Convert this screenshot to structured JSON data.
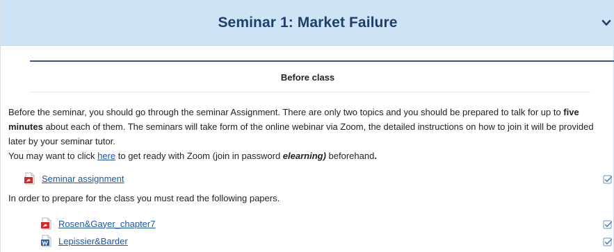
{
  "section": {
    "title": "Seminar 1: Market Failure"
  },
  "summary": {
    "heading": "Before class",
    "intro_part1": "Before the seminar, you should go through the seminar Assignment. There are only two topics and you should be prepared to talk for up to ",
    "intro_bold": "five minutes",
    "intro_part2": " about each of them.  The seminars will take form of the online webinar via Zoom, the detailed instructions on how to join it will be provided later by your seminar tutor.",
    "zoom_part1": "You may want to click ",
    "zoom_link": "here",
    "zoom_part2": " to get ready with Zoom (join in password ",
    "zoom_password": "elearning)",
    "zoom_part3": " beforehand",
    "zoom_end": "."
  },
  "activities": [
    {
      "label": "Seminar assignment",
      "icon": "pdf-icon"
    },
    {
      "label": "Rosen&Gayer_chapter7",
      "icon": "pdf-icon"
    },
    {
      "label": "Lepissier&Barder",
      "icon": "word-icon"
    }
  ],
  "reading_note": "In order to prepare for the class you must read the following papers.",
  "colors": {
    "header_bg": "#cfe3f6",
    "header_text": "#1d3f6a",
    "link": "#1a57a8",
    "rule": "#2d5b9a"
  }
}
